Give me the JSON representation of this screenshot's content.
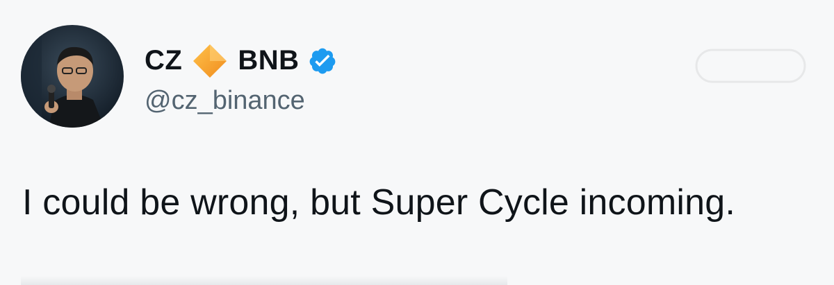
{
  "author": {
    "name_part1": "CZ",
    "name_part2": "BNB",
    "handle": "@cz_binance",
    "avatar_icon": "profile-photo",
    "name_emoji_icon": "orange-diamond-icon",
    "verified_icon": "verified-badge-icon"
  },
  "tweet": {
    "text": "I could be wrong, but Super Cycle incoming."
  },
  "colors": {
    "background": "#f7f8f9",
    "text": "#0f1419",
    "handle": "#536471",
    "verified": "#1d9bf0",
    "diamond": "#f5a623"
  }
}
